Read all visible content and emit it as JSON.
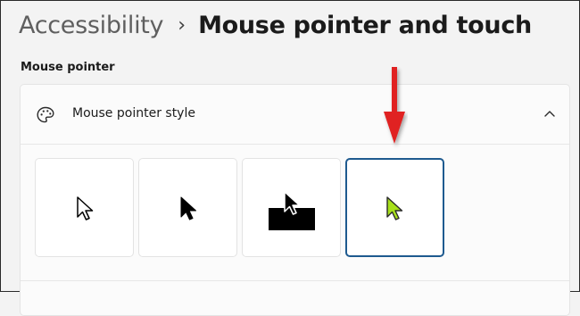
{
  "header": {
    "breadcrumb_parent": "Accessibility",
    "breadcrumb_separator": "›",
    "page_title": "Mouse pointer and touch"
  },
  "section": {
    "label": "Mouse pointer"
  },
  "setting": {
    "label": "Mouse pointer style",
    "icon": "palette-icon",
    "expand_icon": "chevron-up-icon",
    "expanded": true
  },
  "pointer_styles": [
    {
      "name": "White",
      "icon": "cursor-white-icon",
      "selected": false
    },
    {
      "name": "Black",
      "icon": "cursor-black-icon",
      "selected": false
    },
    {
      "name": "Inverted",
      "icon": "cursor-inverted-icon",
      "selected": false
    },
    {
      "name": "Custom",
      "icon": "cursor-custom-green-icon",
      "selected": true,
      "color": "#a7e01b"
    }
  ],
  "annotation": {
    "icon": "red-arrow-icon",
    "color": "#e02020"
  },
  "colors": {
    "page_background": "#f3f3f3",
    "card_background": "#fbfbfb",
    "selected_border": "#1e5a8f",
    "custom_cursor": "#a7e01b"
  }
}
